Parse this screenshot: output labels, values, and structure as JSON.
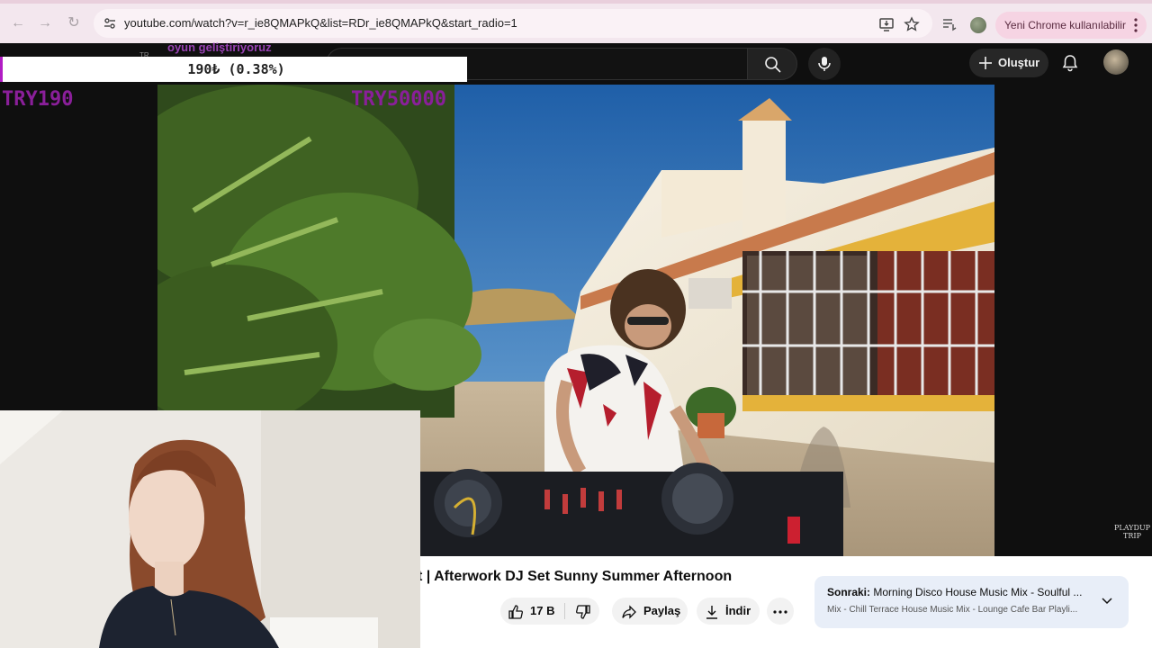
{
  "browser": {
    "url": "youtube.com/watch?v=r_ie8QMAPkQ&list=RDr_ie8QMAPkQ&start_radio=1",
    "update_label": "Yeni Chrome kullanılabilir"
  },
  "youtube": {
    "create_label": "Oluştur"
  },
  "stream_overlay": {
    "subtitle": "oyun geliştiriyoruz",
    "small_tag": "TR",
    "goal_progress_text": "190₺ (0.38%)",
    "goal_progress": 0.0038,
    "goal_min": "TRY190",
    "goal_max": "TRY50000"
  },
  "video": {
    "title": "t | Afterwork DJ Set Sunny Summer Afternoon",
    "watermark": "PLAYDUP TRIP"
  },
  "actions": {
    "likes": "17 B",
    "share": "Paylaş",
    "download": "İndir"
  },
  "up_next": {
    "prefix": "Sonraki:",
    "title": "Morning Disco House Music Mix - Soulful ...",
    "subtitle": "Mix - Chill Terrace House Music Mix - Lounge Cafe Bar Playli..."
  },
  "colors": {
    "overlay_purple": "#8a1f9a",
    "chrome_pill": "#f6d4e3",
    "yt_bg": "#0f0f0f"
  }
}
